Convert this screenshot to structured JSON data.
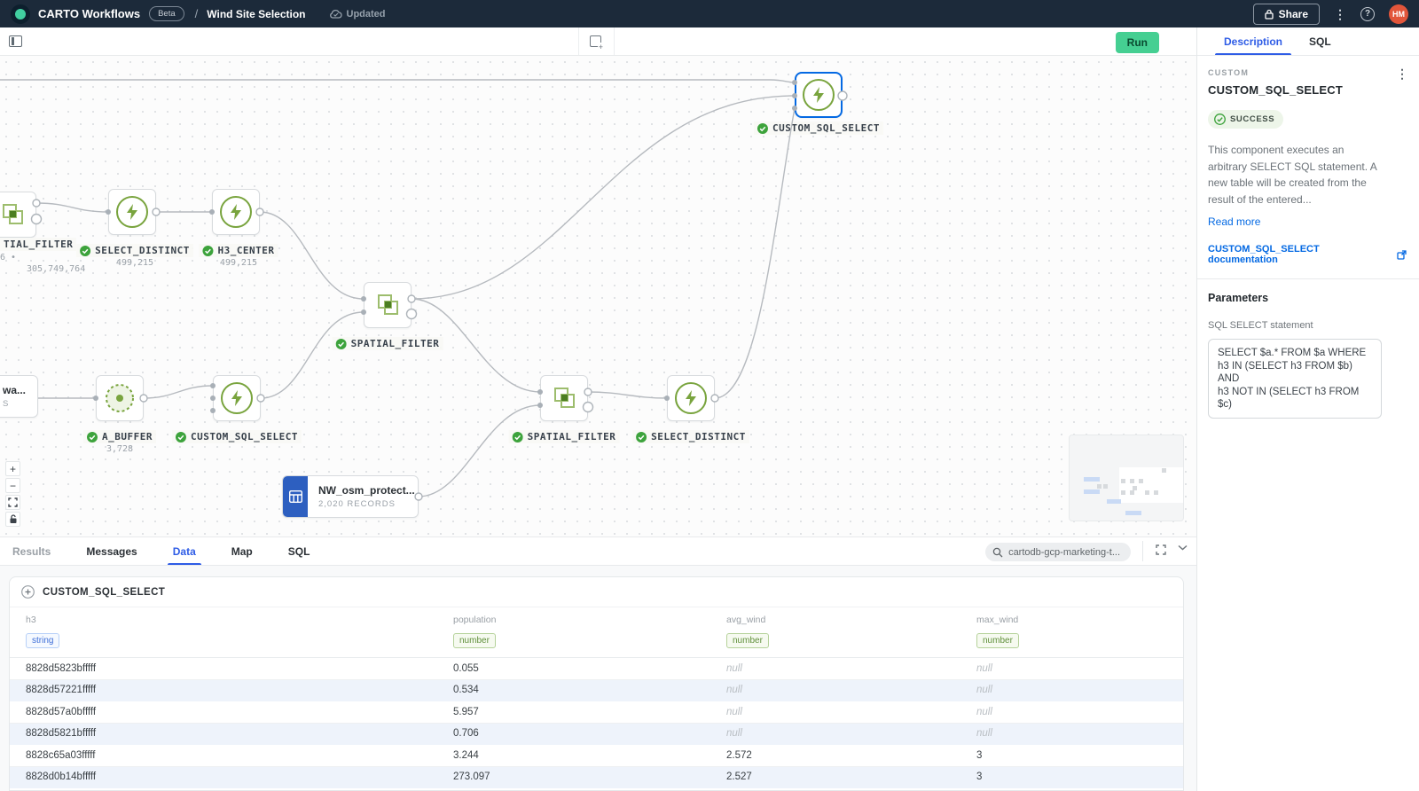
{
  "topbar": {
    "app_title": "CARTO Workflows",
    "beta_badge": "Beta",
    "separator": "/",
    "workflow_title": "Wind Site Selection",
    "updated_label": "Updated",
    "share_label": "Share",
    "avatar_initials": "HM",
    "kebab": "⋮",
    "help": "?"
  },
  "toolbar": {
    "run_label": "Run"
  },
  "canvas": {
    "nodes": [
      {
        "label": "TIAL_FILTER",
        "stat1": "6 •",
        "stat2": "305,749,764"
      },
      {
        "label": "SELECT_DISTINCT",
        "count": "499,215"
      },
      {
        "label": "H3_CENTER",
        "count": "499,215"
      },
      {
        "label": "SPATIAL_FILTER"
      },
      {
        "title": "wa...",
        "subtitle": "S"
      },
      {
        "label": "A_BUFFER",
        "count": "3,728"
      },
      {
        "label": "CUSTOM_SQL_SELECT"
      },
      {
        "label": "SPATIAL_FILTER"
      },
      {
        "label": "SELECT_DISTINCT"
      },
      {
        "label": "CUSTOM_SQL_SELECT",
        "selected": true
      },
      {
        "title": "NW_osm_protect...",
        "subtitle": "2,020 RECORDS"
      }
    ],
    "controls": {
      "zoom_in": "+",
      "zoom_out": "−"
    }
  },
  "panel": {
    "tabs": [
      "Results",
      "Messages",
      "Data",
      "Map",
      "SQL"
    ],
    "active_tab": "Data",
    "connection": "cartodb-gcp-marketing-t...",
    "section_title": "CUSTOM_SQL_SELECT",
    "table": {
      "columns": [
        {
          "name": "h3",
          "type": "string"
        },
        {
          "name": "population",
          "type": "number"
        },
        {
          "name": "avg_wind",
          "type": "number"
        },
        {
          "name": "max_wind",
          "type": "number"
        }
      ],
      "rows": [
        [
          "8828d5823bfffff",
          "0.055",
          "null",
          "null"
        ],
        [
          "8828d57221fffff",
          "0.534",
          "null",
          "null"
        ],
        [
          "8828d57a0bfffff",
          "5.957",
          "null",
          "null"
        ],
        [
          "8828d5821bfffff",
          "0.706",
          "null",
          "null"
        ],
        [
          "8828c65a03fffff",
          "3.244",
          "2.572",
          "3"
        ],
        [
          "8828d0b14bfffff",
          "273.097",
          "2.527",
          "3"
        ]
      ]
    }
  },
  "sidebar": {
    "tabs": [
      "Description",
      "SQL"
    ],
    "active_tab": "Description",
    "overline": "CUSTOM",
    "title": "CUSTOM_SQL_SELECT",
    "status": "SUCCESS",
    "description": "This component executes an arbitrary SELECT SQL statement. A new table will be created from the result of the entered...",
    "read_more": "Read more",
    "doc_link": "CUSTOM_SQL_SELECT documentation",
    "parameters_title": "Parameters",
    "sql_label": "SQL SELECT statement",
    "sql_value": "SELECT $a.* FROM $a WHERE\nh3 IN (SELECT h3 FROM $b)\nAND\nh3 NOT IN (SELECT h3 FROM $c)",
    "kebab": "⋮"
  },
  "colors": {
    "accent": "#2e5ce6",
    "link": "#0469e3",
    "node_green": "#79a43e",
    "run_green": "#45cf92"
  }
}
